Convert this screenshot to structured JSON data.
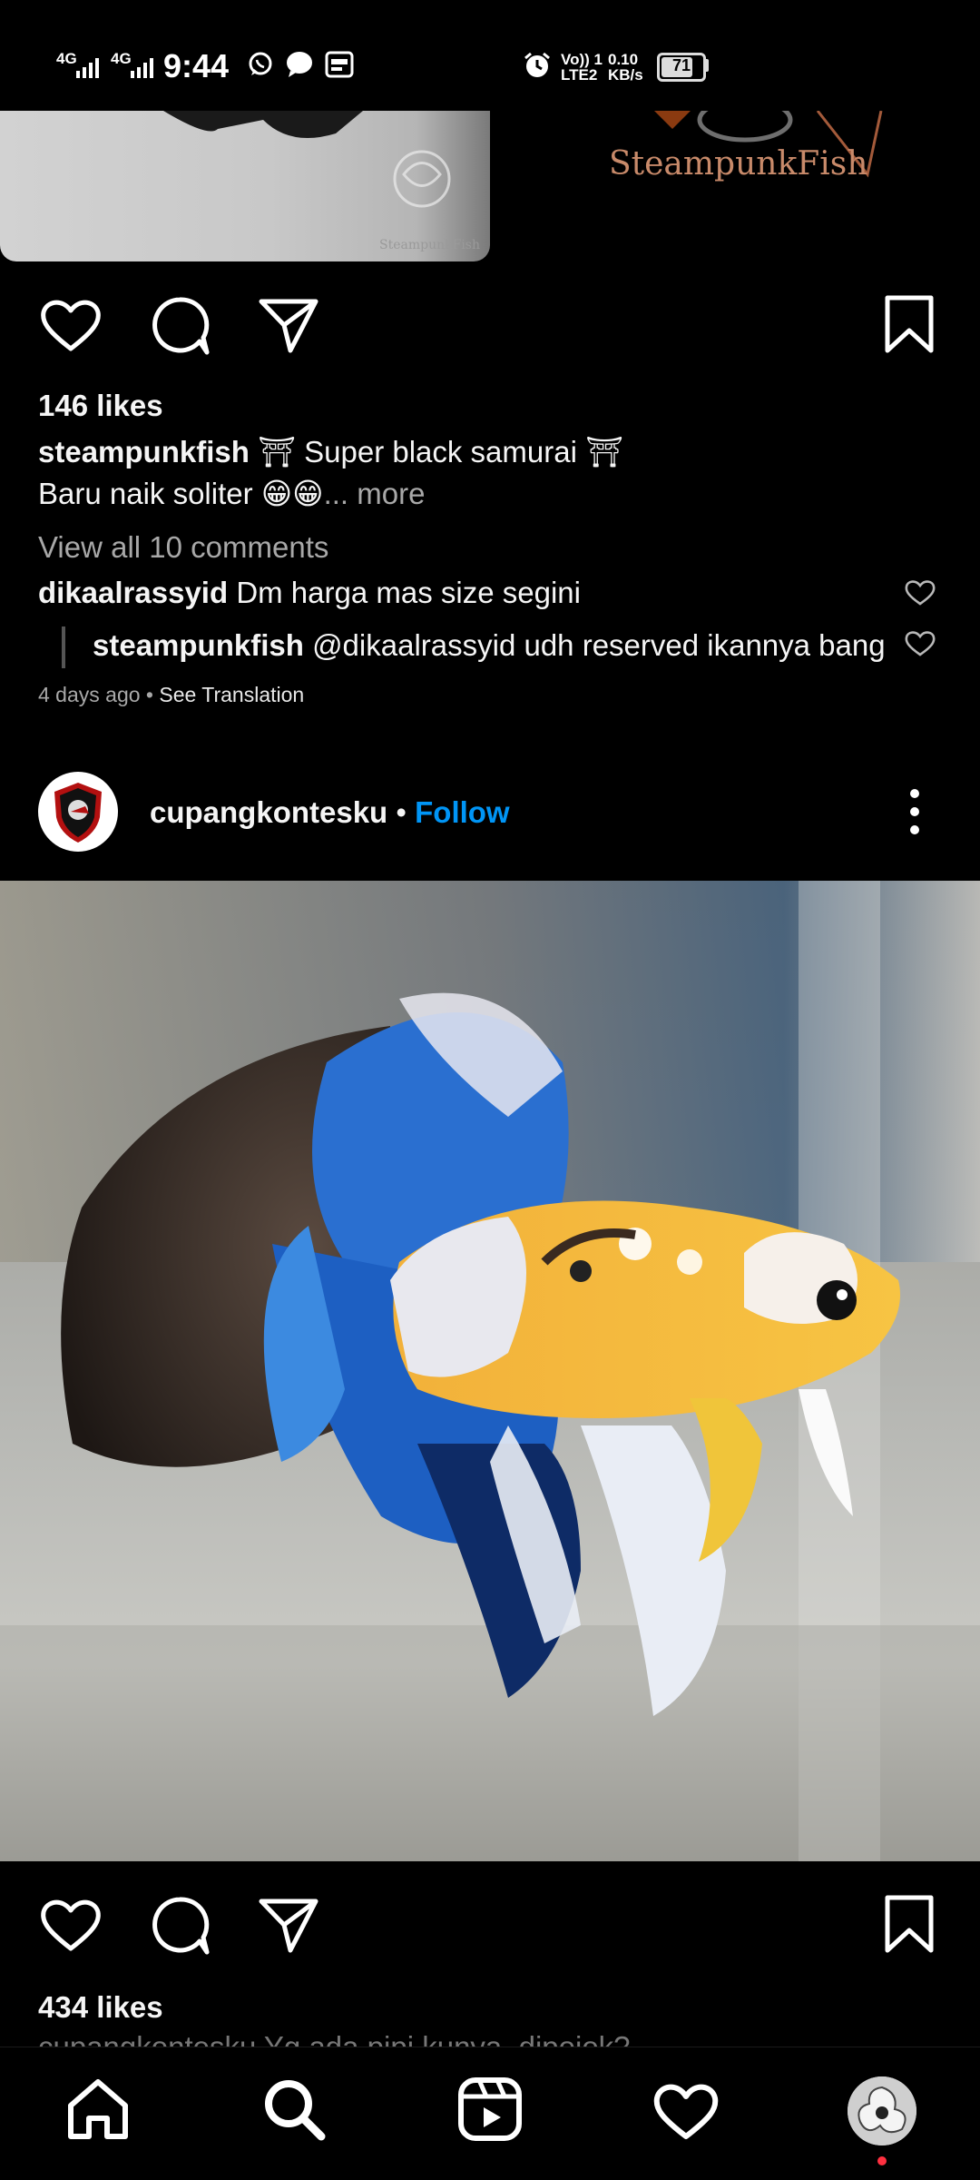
{
  "status_bar": {
    "net1": "4G",
    "net2": "4G",
    "time": "9:44",
    "volte": "Vo)) 1",
    "lte": "LTE2",
    "speed": "0.10",
    "speed_unit": "KB/s",
    "battery": "71",
    "battery_level": 0.71,
    "icons": [
      "signal-icon",
      "whatsapp-icon",
      "message-icon",
      "gallery-icon",
      "alarm-icon"
    ]
  },
  "post1": {
    "thumb_right_brand": "SteampunkFish",
    "thumb_left_watermark": "SteampunkFish",
    "likes": "146 likes",
    "caption_user": "steampunkfish",
    "caption_line1": "⛩ Super black samurai ⛩",
    "caption_line2": "Baru naik soliter 😁😁",
    "more": "... more",
    "view_comments": "View all 10 comments",
    "comments": [
      {
        "user": "dikaalrassyid",
        "text": "Dm harga mas size segini"
      },
      {
        "user": "steampunkfish",
        "text": "@dikaalrassyid udh reserved ikannya bang"
      }
    ],
    "time_ago": "4 days ago",
    "dot": "•",
    "see_translation": "See Translation"
  },
  "post2": {
    "username": "cupangkontesku",
    "dot": "•",
    "follow": "Follow",
    "likes": "434 likes",
    "caption_partial": "cupangkontesku Yg ada pipi kunya..dipojok?"
  },
  "colors": {
    "background": "#000000",
    "text": "#f5f5f5",
    "muted": "#a8a8a8",
    "link": "#0095f6",
    "notification_dot": "#ff3040"
  },
  "bottom_nav": [
    "home-icon",
    "search-icon",
    "reels-icon",
    "activity-heart-icon",
    "profile-avatar"
  ]
}
